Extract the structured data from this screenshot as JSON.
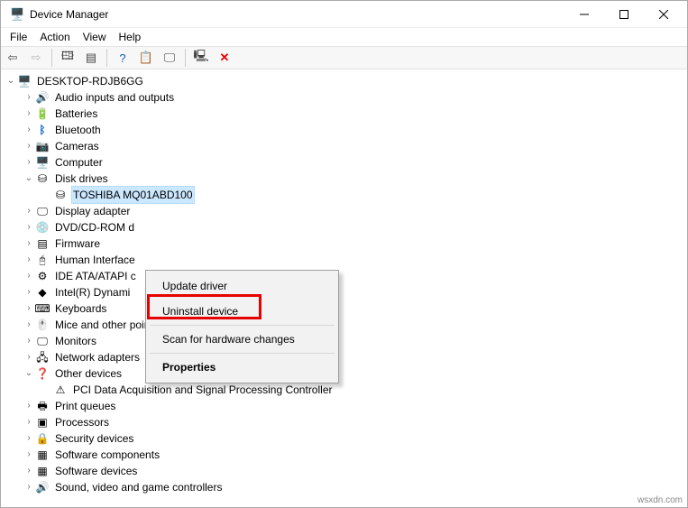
{
  "title": "Device Manager",
  "menu": {
    "file": "File",
    "action": "Action",
    "view": "View",
    "help": "Help"
  },
  "root": "DESKTOP-RDJB6GG",
  "categories": [
    {
      "label": "Audio inputs and outputs",
      "icon": "🔊",
      "exp": "›"
    },
    {
      "label": "Batteries",
      "icon": "🔋",
      "exp": "›"
    },
    {
      "label": "Bluetooth",
      "icon": "ᛒ",
      "exp": "›",
      "iconColor": "#0a66c2"
    },
    {
      "label": "Cameras",
      "icon": "📷",
      "exp": "›"
    },
    {
      "label": "Computer",
      "icon": "🖥️",
      "exp": "›"
    },
    {
      "label": "Disk drives",
      "icon": "⛁",
      "exp": "⌄",
      "expanded": true,
      "children": [
        {
          "label": "TOSHIBA MQ01ABD100",
          "icon": "⛁",
          "selected": true
        }
      ]
    },
    {
      "label": "Display adapter",
      "icon": "🖵",
      "exp": "›"
    },
    {
      "label": "DVD/CD-ROM d",
      "icon": "💿",
      "exp": "›"
    },
    {
      "label": "Firmware",
      "icon": "▤",
      "exp": "›"
    },
    {
      "label": "Human Interface",
      "icon": "🖰",
      "exp": "›"
    },
    {
      "label": "IDE ATA/ATAPI c",
      "icon": "⚙",
      "exp": "›"
    },
    {
      "label": "Intel(R) Dynami",
      "icon": "◆",
      "exp": "›"
    },
    {
      "label": "Keyboards",
      "icon": "⌨",
      "exp": "›"
    },
    {
      "label": "Mice and other pointing devices",
      "icon": "🖱️",
      "exp": "›"
    },
    {
      "label": "Monitors",
      "icon": "🖵",
      "exp": "›"
    },
    {
      "label": "Network adapters",
      "icon": "🖧",
      "exp": "›"
    },
    {
      "label": "Other devices",
      "icon": "❓",
      "exp": "⌄",
      "expanded": true,
      "children": [
        {
          "label": "PCI Data Acquisition and Signal Processing Controller",
          "icon": "⚠"
        }
      ]
    },
    {
      "label": "Print queues",
      "icon": "🖶",
      "exp": "›"
    },
    {
      "label": "Processors",
      "icon": "▣",
      "exp": "›"
    },
    {
      "label": "Security devices",
      "icon": "🔒",
      "exp": "›"
    },
    {
      "label": "Software components",
      "icon": "▦",
      "exp": "›"
    },
    {
      "label": "Software devices",
      "icon": "▦",
      "exp": "›"
    },
    {
      "label": "Sound, video and game controllers",
      "icon": "🔊",
      "exp": "›"
    }
  ],
  "context": {
    "update": "Update driver",
    "uninstall": "Uninstall device",
    "scan": "Scan for hardware changes",
    "properties": "Properties"
  },
  "watermark": "wsxdn.com"
}
